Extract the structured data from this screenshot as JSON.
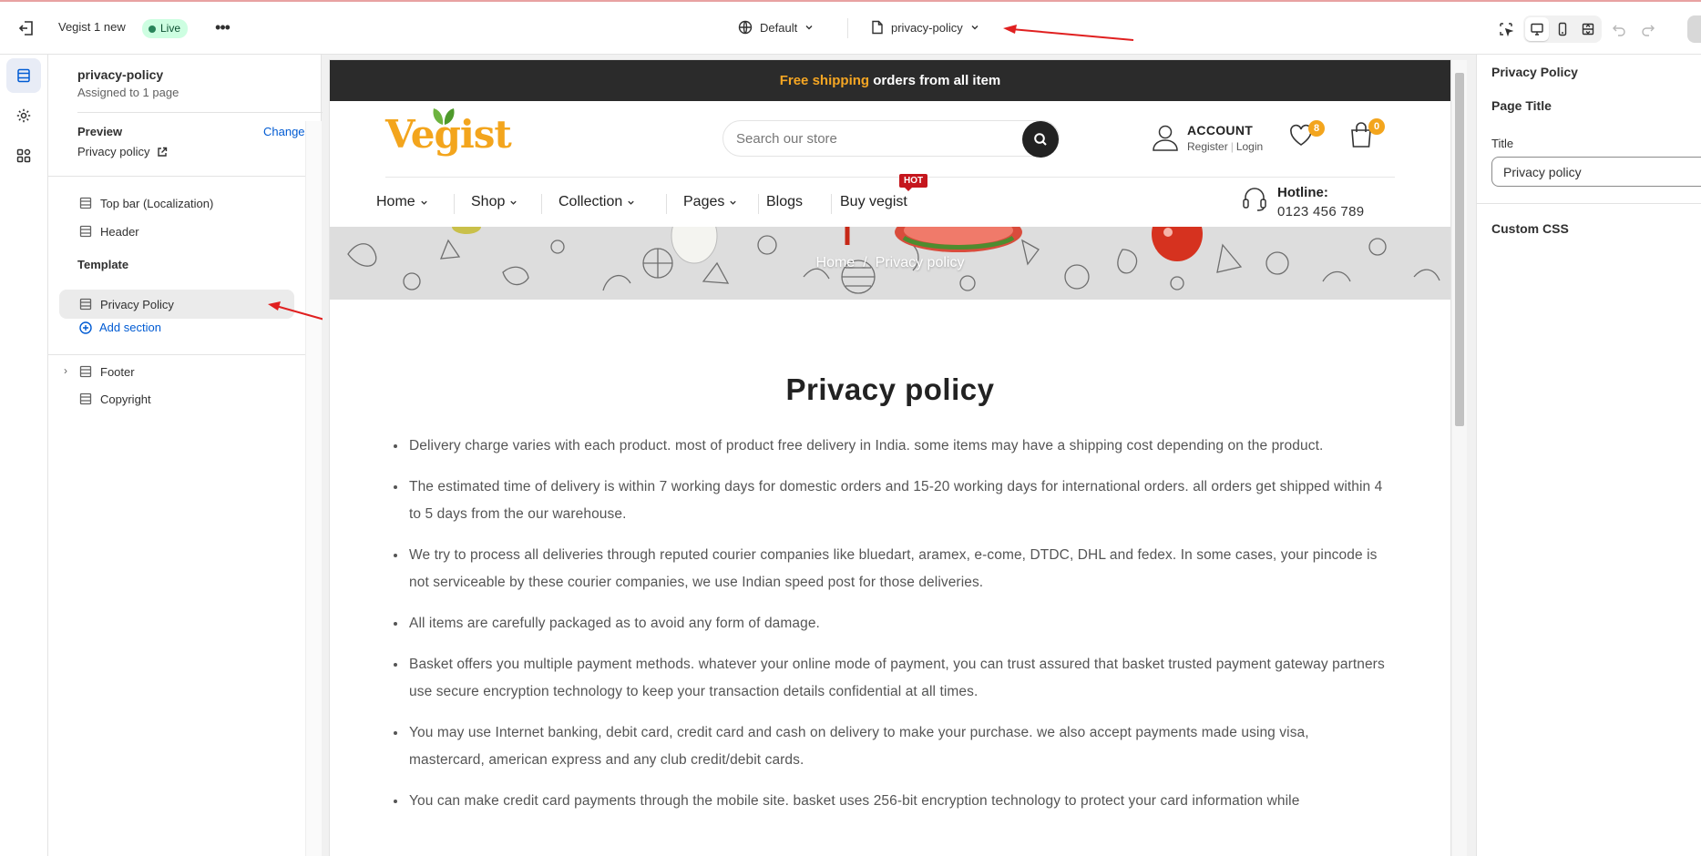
{
  "topbar": {
    "store_name": "Vegist 1 new",
    "status": "Live",
    "more": "•••",
    "theme": "Default",
    "page": "privacy-policy"
  },
  "sidebar": {
    "title": "privacy-policy",
    "subtitle": "Assigned to 1 page",
    "preview_label": "Preview",
    "change_label": "Change",
    "preview_value": "Privacy policy",
    "header_items": [
      "Top bar (Localization)",
      "Header"
    ],
    "template_heading": "Template",
    "template_items": [
      "Privacy Policy"
    ],
    "add_section": "Add section",
    "footer_items": [
      "Footer",
      "Copyright"
    ]
  },
  "store": {
    "announce_highlight": "Free shipping",
    "announce_rest": " orders from all item",
    "logo": "Vegist",
    "search_placeholder": "Search our store",
    "account_title": "ACCOUNT",
    "register": "Register",
    "login": "Login",
    "wishlist_count": "8",
    "cart_count": "0",
    "nav": [
      "Home",
      "Shop",
      "Collection",
      "Pages",
      "Blogs",
      "Buy vegist"
    ],
    "hot_badge": "HOT",
    "hotline_label": "Hotline:",
    "hotline_number": "0123 456 789",
    "breadcrumb_home": "Home",
    "breadcrumb_sep": "/",
    "breadcrumb_current": "Privacy policy",
    "page_title": "Privacy policy",
    "paragraphs": [
      "Delivery charge varies with each product. most of product free delivery in India. some items may have a shipping cost depending on the product.",
      "The estimated time of delivery is within 7 working days for domestic orders and 15-20 working days for international orders. all orders get shipped within 4 to 5 days from the our warehouse.",
      "We try to process all deliveries through reputed courier companies like bluedart, aramex, e-come, DTDC, DHL and fedex. In some cases, your pincode is not serviceable by these courier companies, we use Indian speed post for those deliveries.",
      "All items are carefully packaged as to avoid any form of damage.",
      "Basket offers you multiple payment methods. whatever your online mode of payment, you can trust assured that basket trusted payment gateway partners use secure encryption technology to keep your transaction details confidential at all times.",
      "You may use Internet banking, debit card, credit card and cash on delivery to make your purchase. we also accept payments made using visa, mastercard, american express and any club credit/debit cards.",
      "You can make credit card payments through the mobile site. basket uses 256-bit encryption technology to protect your card information while"
    ]
  },
  "right_panel": {
    "heading": "Privacy Policy",
    "section": "Page Title",
    "field_label": "Title",
    "field_value": "Privacy policy",
    "custom_css": "Custom CSS"
  },
  "colors": {
    "accent": "#005bd3",
    "brand_orange": "#f3a51d",
    "annotation_red": "#e02020",
    "live_green": "#29845a"
  },
  "icons": [
    "exit-icon",
    "globe-icon",
    "page-icon",
    "chevron-down-icon",
    "inspector-icon",
    "desktop-icon",
    "mobile-icon",
    "fullscreen-icon",
    "undo-icon",
    "redo-icon",
    "sections-icon",
    "settings-icon",
    "apps-icon",
    "section-icon",
    "external-link-icon",
    "plus-circle-icon",
    "search-icon",
    "user-icon",
    "heart-icon",
    "bag-icon",
    "headset-icon"
  ]
}
